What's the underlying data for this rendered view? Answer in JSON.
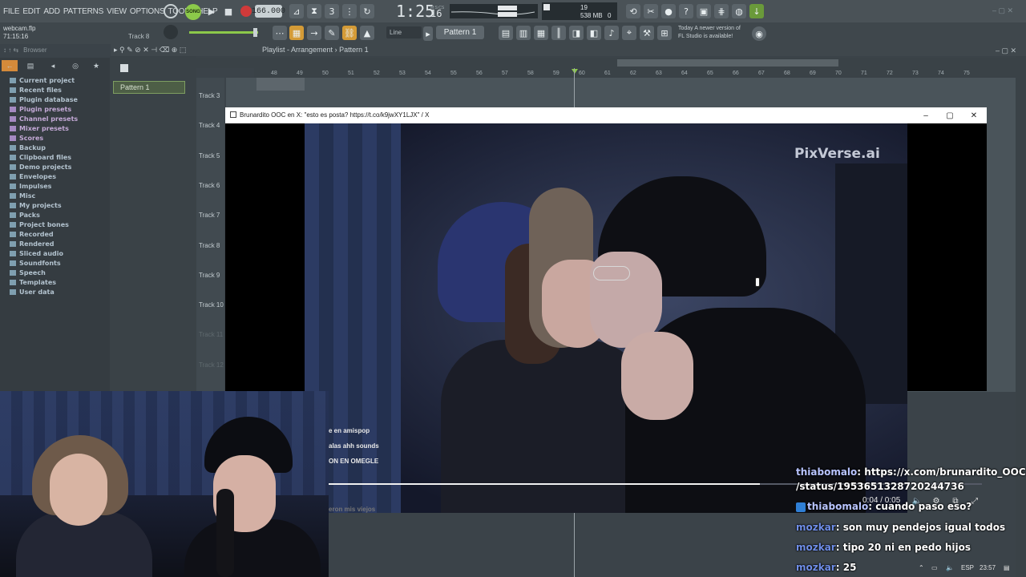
{
  "menubar": {
    "items": [
      "FILE",
      "EDIT",
      "ADD",
      "PATTERNS",
      "VIEW",
      "OPTIONS",
      "TOOLS",
      "HELP"
    ],
    "song_label": "SONG",
    "tempo": "166.000",
    "time_main": "1:25",
    "time_small": "16",
    "time_unit": "M:S:CS",
    "cpu_value": "19",
    "ram_value": "538 MB",
    "voices": "0"
  },
  "toolbar2": {
    "file_name": "webcam.flp",
    "file_time": "71:15:16",
    "track_hint": "Track 8",
    "snap_mode": "Line",
    "pattern_selector": "Pattern 1",
    "notice_line1": "Today  A newer version of",
    "notice_line2": "FL Studio is available!"
  },
  "browser": {
    "header": "Browser",
    "items": [
      {
        "label": "Current project",
        "style": "normal"
      },
      {
        "label": "Recent files",
        "style": "normal"
      },
      {
        "label": "Plugin database",
        "style": "normal"
      },
      {
        "label": "Plugin presets",
        "style": "purple"
      },
      {
        "label": "Channel presets",
        "style": "purple"
      },
      {
        "label": "Mixer presets",
        "style": "purple"
      },
      {
        "label": "Scores",
        "style": "purple"
      },
      {
        "label": "Backup",
        "style": "normal"
      },
      {
        "label": "Clipboard files",
        "style": "normal"
      },
      {
        "label": "Demo projects",
        "style": "normal"
      },
      {
        "label": "Envelopes",
        "style": "normal"
      },
      {
        "label": "Impulses",
        "style": "normal"
      },
      {
        "label": "Misc",
        "style": "normal"
      },
      {
        "label": "My projects",
        "style": "normal"
      },
      {
        "label": "Packs",
        "style": "normal"
      },
      {
        "label": "Project bones",
        "style": "normal"
      },
      {
        "label": "Recorded",
        "style": "normal"
      },
      {
        "label": "Rendered",
        "style": "normal"
      },
      {
        "label": "Sliced audio",
        "style": "normal"
      },
      {
        "label": "Soundfonts",
        "style": "normal"
      },
      {
        "label": "Speech",
        "style": "normal"
      },
      {
        "label": "Templates",
        "style": "normal"
      },
      {
        "label": "User data",
        "style": "normal"
      }
    ]
  },
  "playlist": {
    "title": "Playlist - Arrangement",
    "breadcrumb_pattern": "Pattern 1",
    "pattern_item": "Pattern 1",
    "ruler": [
      "48",
      "49",
      "50",
      "51",
      "52",
      "53",
      "54",
      "55",
      "56",
      "57",
      "58",
      "59",
      "60",
      "61",
      "62",
      "63",
      "64",
      "65",
      "66",
      "67",
      "68",
      "69",
      "70",
      "71",
      "72",
      "73",
      "74",
      "75"
    ],
    "tracks": [
      "Track 3",
      "Track 4",
      "Track 5",
      "Track 6",
      "Track 7",
      "Track 8",
      "Track 9",
      "Track 10",
      "Track 11",
      "Track 12"
    ]
  },
  "video_window": {
    "title": "Brunardito OOC en X: \"esto es posta? https://t.co/k9jwXY1LJX\" / X",
    "watermark": "PixVerse.ai",
    "time": "0:04 / 0:05",
    "progress": 0.66,
    "subtitles": [
      "e en amispop",
      "alas ahh sounds",
      "ON EN OMEGLE",
      "eron mis viejos"
    ]
  },
  "chat": [
    {
      "user": "thiabomalo",
      "text": "https://x.com/brunardito_OOC",
      "badge": false
    },
    {
      "user": "",
      "text": "/status/1953651328720244736",
      "badge": false
    },
    {
      "user": "thiabomalo",
      "text": "cuando paso eso?",
      "badge": true
    },
    {
      "user": "mozkar",
      "text": "son muy pendejos igual todos",
      "badge": false
    },
    {
      "user": "mozkar",
      "text": "tipo 20 ni en pedo hijos",
      "badge": false
    },
    {
      "user": "mozkar",
      "text": "25",
      "badge": false
    }
  ],
  "tray": {
    "lang": "ESP",
    "clock": "23:57"
  }
}
